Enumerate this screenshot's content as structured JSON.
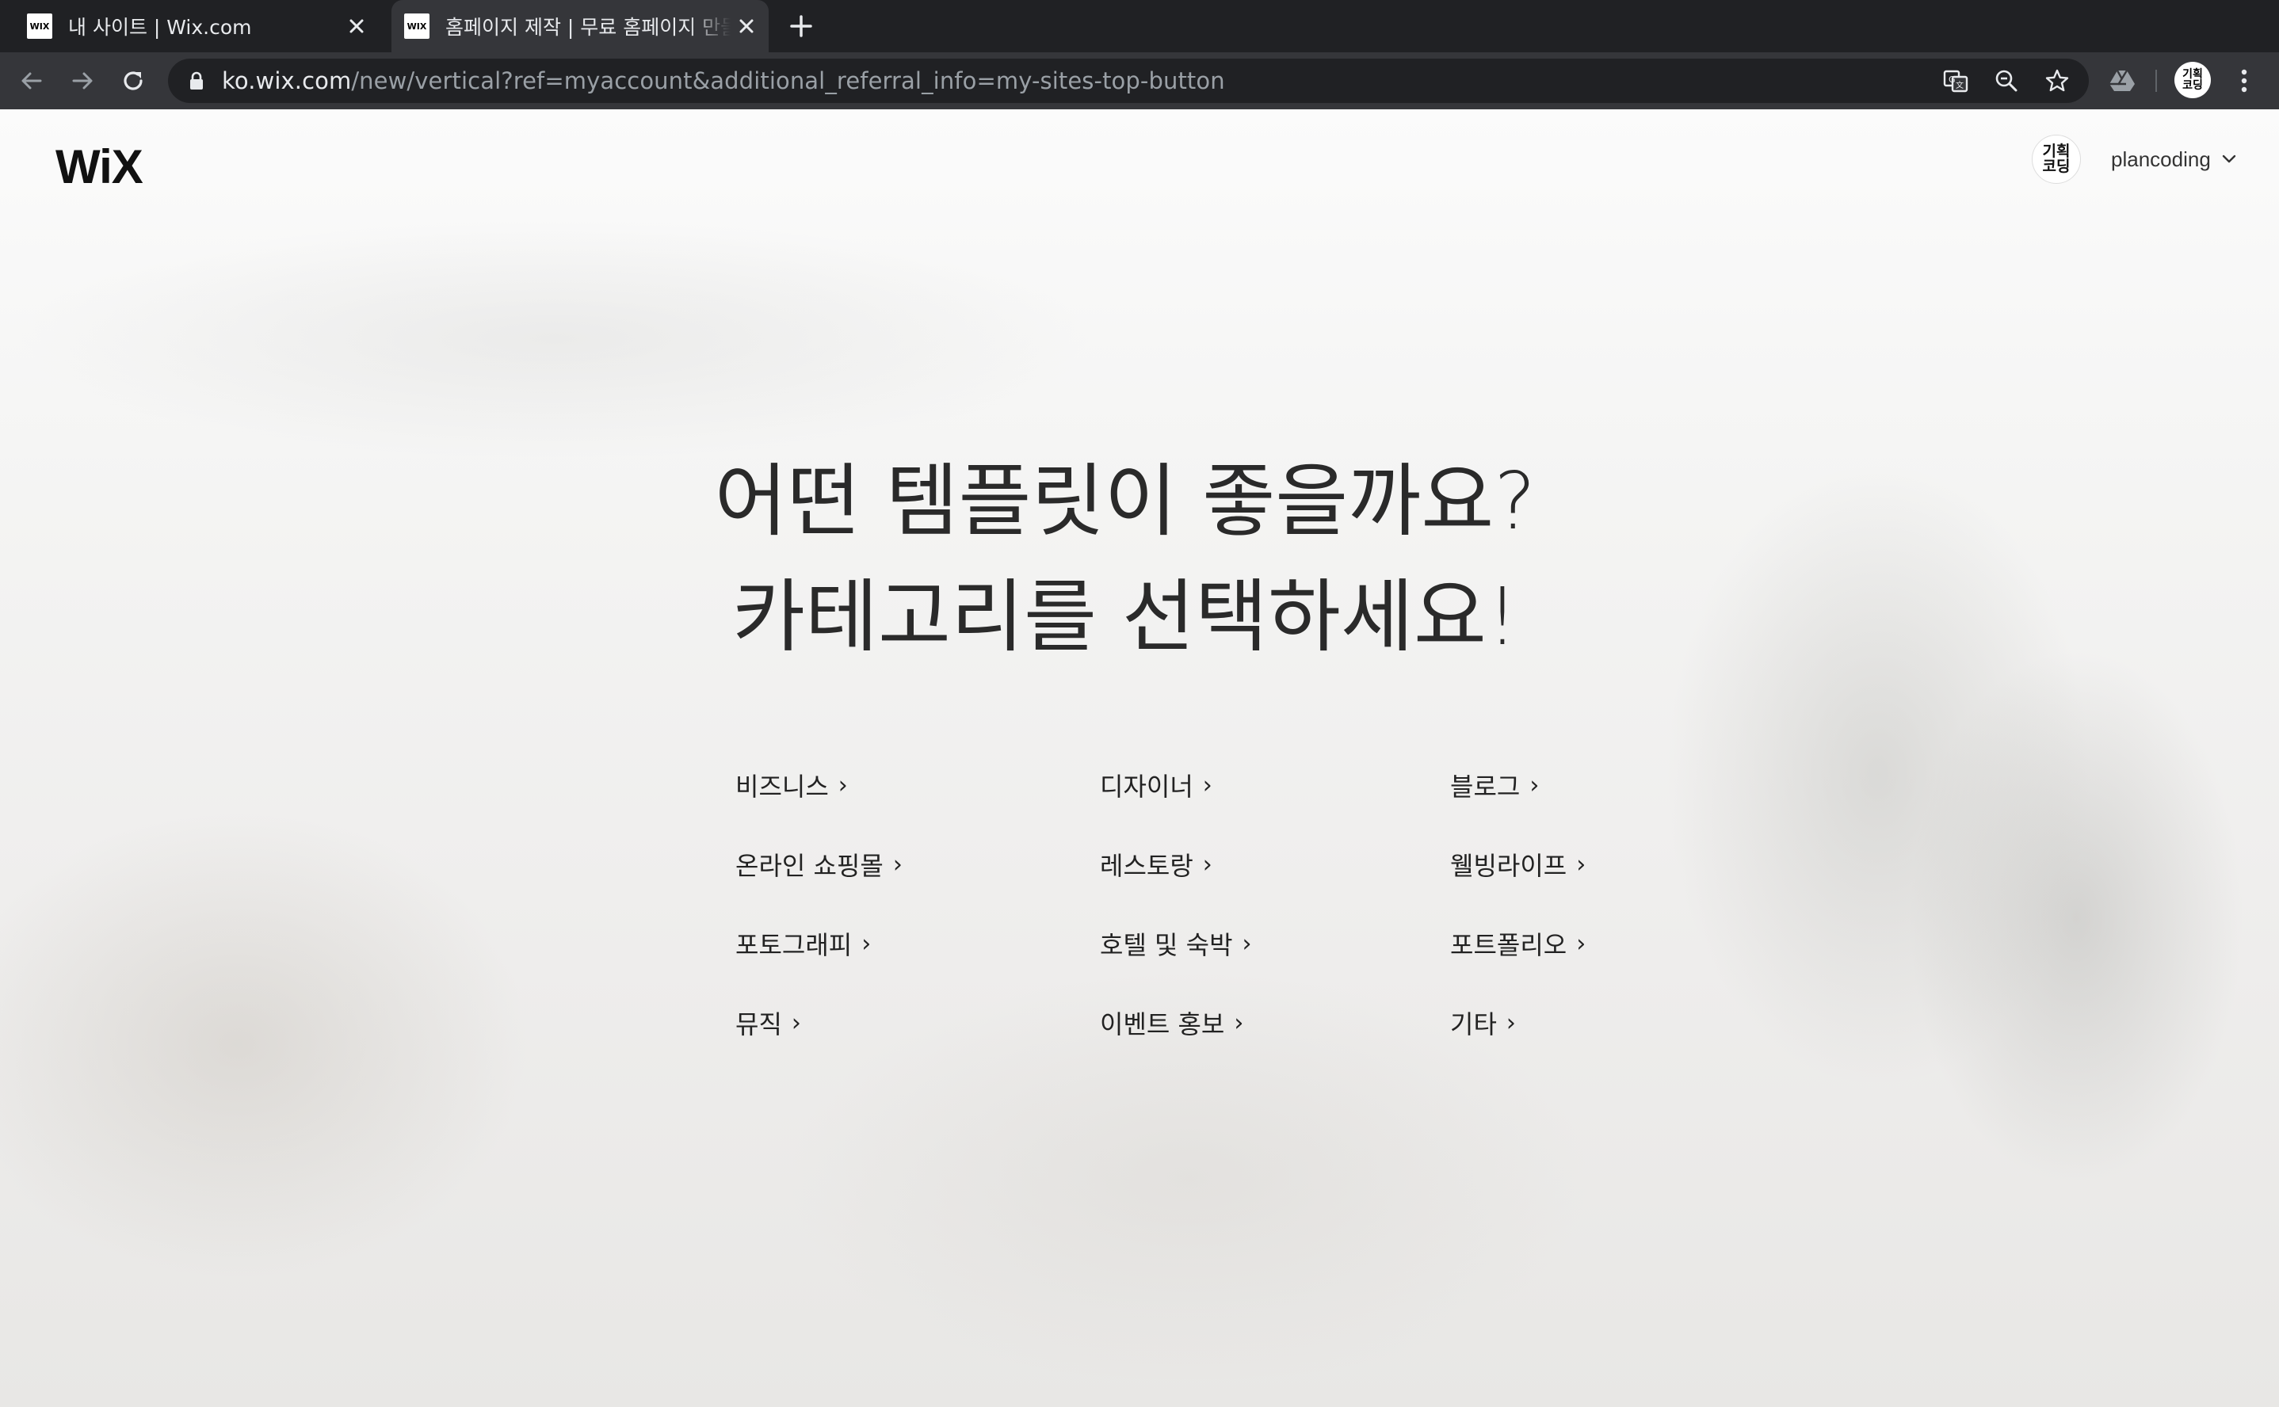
{
  "browser": {
    "tabs": [
      {
        "favicon": "WIX",
        "title": "내 사이트 | Wix.com",
        "active": false
      },
      {
        "favicon": "WIX",
        "title": "홈페이지 제작 | 무료 홈페이지 만들기",
        "active": true
      }
    ],
    "url_host": "ko.wix.com",
    "url_path": "/new/vertical?ref=myaccount&additional_referral_info=my-sites-top-button",
    "profile_initials": "기획\n코딩",
    "icons": {
      "back": "arrow-left-icon",
      "forward": "arrow-right-icon",
      "reload": "reload-icon",
      "lock": "lock-icon",
      "translate": "translate-icon",
      "zoom": "zoom-out-icon",
      "bookmark": "star-icon",
      "extension": "google-drive-icon",
      "menu": "kebab-menu-icon",
      "close": "close-icon",
      "new_tab": "plus-icon"
    }
  },
  "header": {
    "logo": "WiX",
    "user_avatar": "기획\n코딩",
    "username": "plancoding"
  },
  "headline": {
    "line1": "어떤 템플릿이 좋을까요?",
    "line2": "카테고리를 선택하세요!"
  },
  "categories": [
    [
      "비즈니스",
      "디자이너",
      "블로그"
    ],
    [
      "온라인 쇼핑몰",
      "레스토랑",
      "웰빙라이프"
    ],
    [
      "포토그래피",
      "호텔 및 숙박",
      "포트폴리오"
    ],
    [
      "뮤직",
      "이벤트 홍보",
      "기타"
    ]
  ],
  "colors": {
    "tabstrip_bg": "#202124",
    "toolbar_bg": "#35363a",
    "omnibox_bg": "#202124",
    "text_primary": "#222222"
  }
}
